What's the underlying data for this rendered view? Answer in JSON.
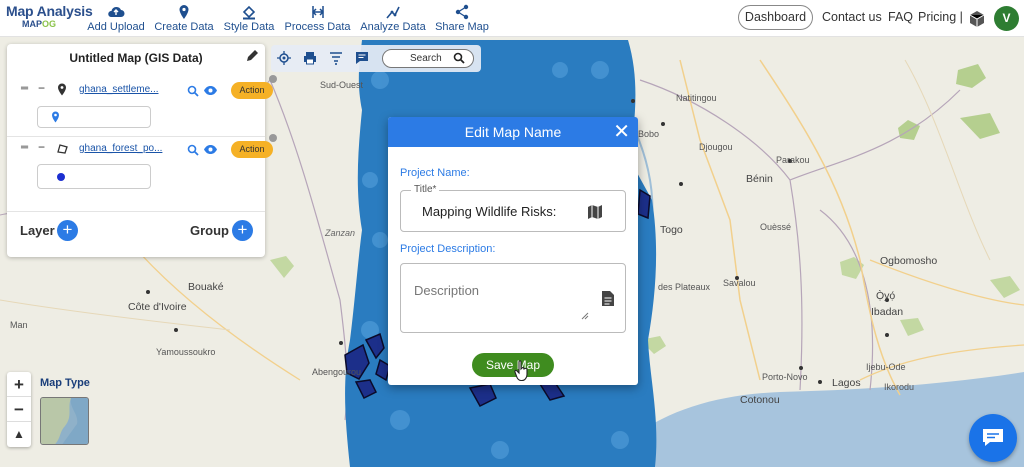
{
  "app": {
    "brand_title": "Map Analysis",
    "brand_sub_a": "MAP",
    "brand_sub_b": "OG"
  },
  "nav": {
    "items": [
      {
        "label": "Add Upload",
        "icon": "cloud-upload-icon"
      },
      {
        "label": "Create Data",
        "icon": "map-pin-icon"
      },
      {
        "label": "Style Data",
        "icon": "paint-bucket-icon"
      },
      {
        "label": "Process Data",
        "icon": "process-icon"
      },
      {
        "label": "Analyze Data",
        "icon": "analyze-icon"
      },
      {
        "label": "Share Map",
        "icon": "share-icon"
      }
    ],
    "dashboard": "Dashboard",
    "contact": "Contact us",
    "faq": "FAQ",
    "pricing": "Pricing |",
    "avatar_letter": "V"
  },
  "panel": {
    "title": "Untitled Map (GIS Data)",
    "layers": [
      {
        "name": "ghana_settleme...",
        "action": "Action",
        "icon": "map-pin-icon"
      },
      {
        "name": "ghana_forest_po...",
        "action": "Action",
        "icon": "polygon-icon"
      }
    ],
    "layer_label": "Layer",
    "group_label": "Group"
  },
  "toolbar": {
    "search_label": "Search"
  },
  "map_type": {
    "label": "Map Type"
  },
  "places": {
    "sud_ouest": "Sud-Ouest",
    "bobo": "Bobo",
    "natitingou": "Natitingou",
    "djougou": "Djougou",
    "parakou": "Parakou",
    "benin": "Bénin",
    "togo": "Togo",
    "ouesse": "Ouèssé",
    "savalou": "Savalou",
    "ogbomosho": "Ogbomosho",
    "oyo": "Ọ̀yọ́",
    "ibadan": "Ibadan",
    "bouake": "Bouaké",
    "cote_divoire": "Côte d'Ivoire",
    "man": "Man",
    "yamoussoukro": "Yamoussoukro",
    "abengourou": "Abengourou",
    "zanzan": "Zanzan",
    "porto_novo": "Porto-Novo",
    "lagos": "Lagos",
    "cotonou": "Cotonou",
    "ijebu_ode": "Ijebu-Ode",
    "des_plateaux": "des Plateaux",
    "ikorodu": "Ikorodu"
  },
  "modal": {
    "header": "Edit Map Name",
    "close": "✕",
    "project_name_label": "Project Name:",
    "title_floating_label": "Title*",
    "title_value": "Mapping Wildlife Risks:",
    "project_description_label": "Project Description:",
    "description_placeholder": "Description",
    "save_button": "Save Map"
  },
  "colors": {
    "brand_blue": "#2b4f8c",
    "accent_blue": "#2c7be5",
    "layer_fill": "#2a7cc0",
    "action_orange": "#f5b126",
    "save_green": "#3f8c1f"
  }
}
